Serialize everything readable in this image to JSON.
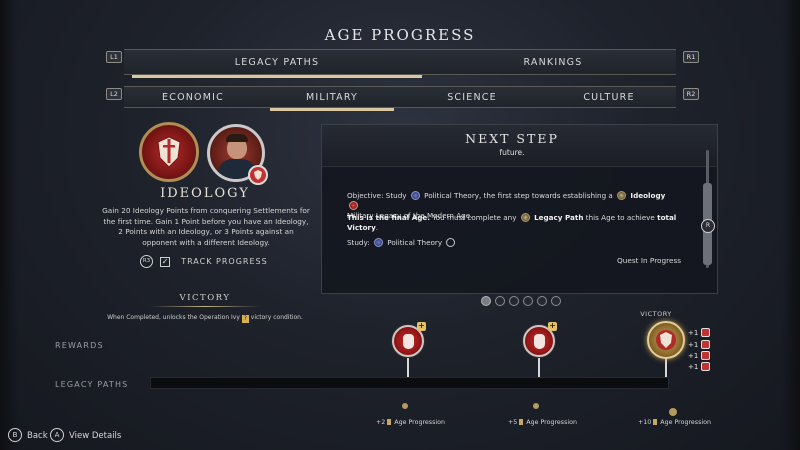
{
  "title": "AGE PROGRESS",
  "top_tabs": [
    {
      "label": "LEGACY PATHS",
      "active": true
    },
    {
      "label": "RANKINGS",
      "active": false
    }
  ],
  "top_tabs_left_hint": "L1",
  "top_tabs_right_hint": "R1",
  "sub_tabs": [
    {
      "label": "ECONOMIC",
      "active": false
    },
    {
      "label": "MILITARY",
      "active": true
    },
    {
      "label": "SCIENCE",
      "active": false
    },
    {
      "label": "CULTURE",
      "active": false
    }
  ],
  "sub_tabs_left_hint": "L2",
  "sub_tabs_right_hint": "R2",
  "ideology": {
    "name": "IDEOLOGY",
    "description": "Gain 20 Ideology Points from conquering Settlements for the first time. Gain 1 Point before you have an Ideology, 2 Points with an Ideology, or 3 Points against an opponent with a different Ideology.",
    "track_hint": "R3",
    "track_label": "TRACK PROGRESS",
    "track_checked": true
  },
  "victory": {
    "title": "VICTORY",
    "subtitle_pre": "When Completed, unlocks the Operation Ivy",
    "subtitle_post": "victory condition."
  },
  "next_step": {
    "title": "NEXT STEP",
    "subtitle": "future.",
    "objective_a": "Objective: Study",
    "objective_b": "Political Theory, the first step towards establishing a",
    "objective_c": "Ideology",
    "objective_d": "Military Legacy of the Modern Age.",
    "final_bold": "This is the final Age.",
    "final_rest_a": "You must complete any",
    "final_legacy": "Legacy Path",
    "final_rest_b": "this Age to achieve",
    "final_victory_a": "total",
    "final_victory_b": "Victory",
    "study_label": "Study:",
    "study_item": "Political Theory",
    "status": "Quest In Progress",
    "scroll_hint": "R"
  },
  "page_dots": {
    "count": 6,
    "active": 0
  },
  "timeline": {
    "rewards_label": "REWARDS",
    "paths_label": "LEGACY PATHS",
    "victory_label": "VICTORY",
    "milestones": [
      {
        "progress": 2,
        "label": "+2",
        "text": "Age Progression"
      },
      {
        "progress": 5,
        "label": "+5",
        "text": "Age Progression"
      },
      {
        "progress": 10,
        "label": "+10",
        "text": "Age Progression"
      }
    ],
    "victory_bonuses": [
      "+1",
      "+1",
      "+1",
      "+1"
    ]
  },
  "footer": {
    "back_hint": "B",
    "back_label": "Back",
    "details_hint": "A",
    "details_label": "View Details"
  },
  "colors": {
    "accent_gold": "#d8c7a0",
    "reward_red": "#c62c2c",
    "background": "#1e222b"
  }
}
